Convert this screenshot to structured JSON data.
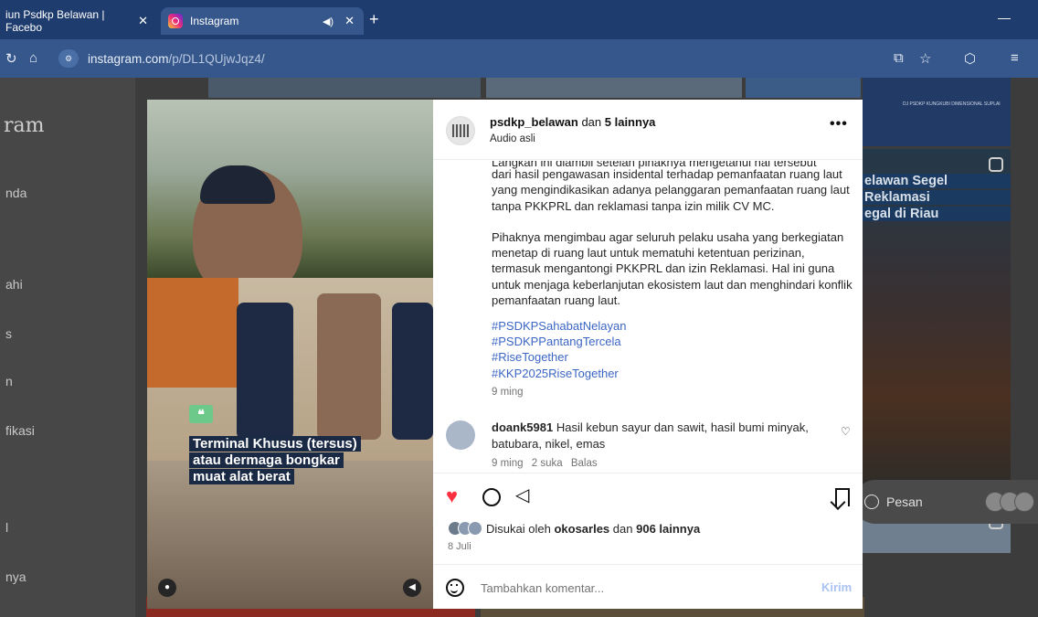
{
  "browser": {
    "tabs": [
      {
        "label": "iun Psdkp Belawan | Facebo",
        "close": "✕"
      },
      {
        "label": "Instagram",
        "close": "✕",
        "audio": "◀)"
      }
    ],
    "new_tab": "+",
    "minimize": "—",
    "url_host": "instagram.com",
    "url_path": "/p/DL1QUjwJqz4/"
  },
  "sidebar": {
    "logo": "ram",
    "items": [
      "nda",
      "ahi",
      "s",
      "n",
      "fikasi",
      "l",
      "nya"
    ]
  },
  "background": {
    "news_lines": [
      "elawan Segel",
      "Reklamasi",
      "egal di Riau"
    ],
    "pesan_label": "Pesan",
    "tiny_caption": "DJ PSDKP KUNGKUBI DIMENSIONAL SUPLAI"
  },
  "video": {
    "quote_mark": "❝",
    "caption_lines": [
      "Terminal Khusus (tersus)",
      "atau dermaga bongkar",
      "muat alat berat"
    ]
  },
  "post": {
    "username": "psdkp_belawan",
    "coauthors_prefix": "dan",
    "coauthors": "5 lainnya",
    "audio": "Audio asli",
    "more": "•••",
    "cut_line": "Langkah ini diambil setelah pihaknya mengetahui hal tersebut",
    "paragraphs": [
      "dari hasil pengawasan insidental terhadap pemanfaatan ruang laut yang mengindikasikan adanya pelanggaran pemanfaatan ruang laut tanpa PKKPRL dan reklamasi tanpa izin milik CV MC.",
      "Pihaknya mengimbau agar seluruh pelaku usaha yang berkegiatan menetap di ruang laut untuk mematuhi ketentuan perizinan, termasuk mengantongi PKKPRL dan izin Reklamasi. Hal ini guna untuk menjaga keberlanjutan ekosistem laut dan menghindari konflik pemanfaatan ruang laut."
    ],
    "hashtags": [
      "#PSDKPSahabatNelayan",
      "#PSDKPPantangTercela",
      "#RiseTogether",
      "#KKP2025RiseTogether"
    ],
    "time": "9 ming",
    "comment": {
      "username": "doank5981",
      "text": "Hasil kebun sayur dan sawit, hasil bumi minyak, batubara, nikel, emas",
      "time": "9 ming",
      "likes": "2 suka",
      "reply": "Balas"
    },
    "liked_prefix": "Disukai oleh",
    "liked_user": "okosarles",
    "liked_mid": "dan",
    "liked_count": "906 lainnya",
    "date": "8 Juli",
    "comment_placeholder": "Tambahkan komentar...",
    "send": "Kirim"
  },
  "colors": {
    "accent_blue": "#3b66c4",
    "heart": "#ff3040",
    "tab_bar": "#1f3c6e"
  }
}
